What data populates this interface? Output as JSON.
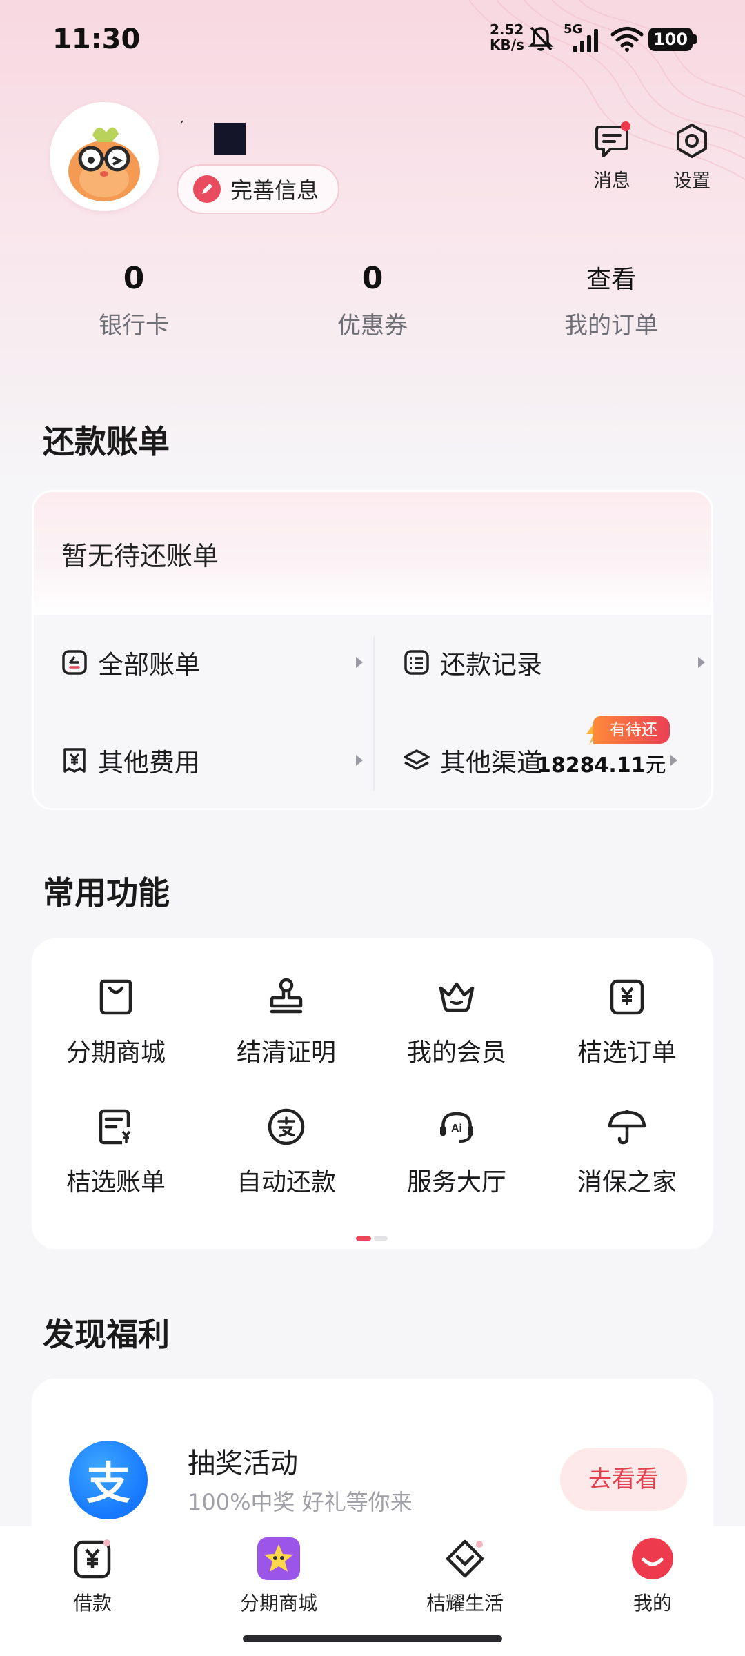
{
  "status_bar": {
    "time": "11:30",
    "net_speed_value": "2.52",
    "net_speed_unit": "KB/s",
    "network": "5G",
    "battery": "100"
  },
  "profile": {
    "complete_info_label": "完善信息",
    "messages_label": "消息",
    "settings_label": "设置"
  },
  "stats": [
    {
      "value": "0",
      "label": "银行卡"
    },
    {
      "value": "0",
      "label": "优惠券"
    },
    {
      "value": "查看",
      "label": "我的订单"
    }
  ],
  "repayment": {
    "title": "还款账单",
    "empty_text": "暂无待还账单",
    "items": [
      {
        "label": "全部账单"
      },
      {
        "label": "还款记录"
      },
      {
        "label": "其他费用"
      },
      {
        "label": "其他渠道"
      }
    ],
    "other_channel_amount": "18284.11",
    "other_channel_unit": "元",
    "pending_badge": "有待还"
  },
  "functions": {
    "title": "常用功能",
    "items": [
      {
        "label": "分期商城",
        "icon": "shopping-bag-icon"
      },
      {
        "label": "结清证明",
        "icon": "stamp-icon"
      },
      {
        "label": "我的会员",
        "icon": "crown-icon"
      },
      {
        "label": "桔选订单",
        "icon": "yen-box-icon"
      },
      {
        "label": "桔选账单",
        "icon": "bill-yen-icon"
      },
      {
        "label": "自动还款",
        "icon": "alipay-circle-icon"
      },
      {
        "label": "服务大厅",
        "icon": "ai-service-icon"
      },
      {
        "label": "消保之家",
        "icon": "umbrella-icon"
      }
    ]
  },
  "welfare": {
    "title": "发现福利",
    "card_title": "抽奖活动",
    "card_subtitle": "100%中奖 好礼等你来",
    "button": "去看看",
    "logo_char": "支"
  },
  "tabs": [
    {
      "label": "借款"
    },
    {
      "label": "分期商城"
    },
    {
      "label": "桔耀生活"
    },
    {
      "label": "我的"
    }
  ],
  "colors": {
    "accent": "#ea4658",
    "button_bg": "#fde8ea",
    "top_gradient": "#f8d8e1"
  }
}
